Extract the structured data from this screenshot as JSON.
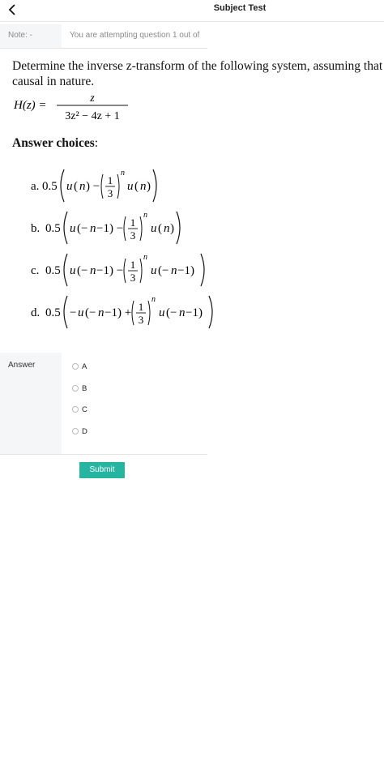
{
  "header": {
    "title": "Subject Test"
  },
  "note": {
    "label": "Note: -",
    "text": "You are attempting question 1 out of"
  },
  "question": {
    "line1": "Determine the inverse z-transform of the following system, assuming that it is",
    "line2": "causal in nature.",
    "formula": {
      "lhs": "H(z) =",
      "numerator": "z",
      "denominator": "3z² − 4z + 1"
    }
  },
  "answer_choices": {
    "title": "Answer choices",
    "items": [
      {
        "label": "a.",
        "expr": "0.5( u(n) − (1/3)^n u(n) )"
      },
      {
        "label": "b.",
        "expr": "0.5( u(−n−1) − (1/3)^n u(n) )"
      },
      {
        "label": "c.",
        "expr": "0.5( u(−n−1) − (1/3)^n u(−n−1) )"
      },
      {
        "label": "d.",
        "expr": "0.5( −u(−n−1) + (1/3)^n u(−n−1) )"
      }
    ]
  },
  "answer": {
    "label": "Answer",
    "options": [
      "A",
      "B",
      "C",
      "D"
    ]
  },
  "submit_label": "Submit",
  "colors": {
    "accent": "#26b5a0",
    "panel": "#f5f6f8"
  }
}
